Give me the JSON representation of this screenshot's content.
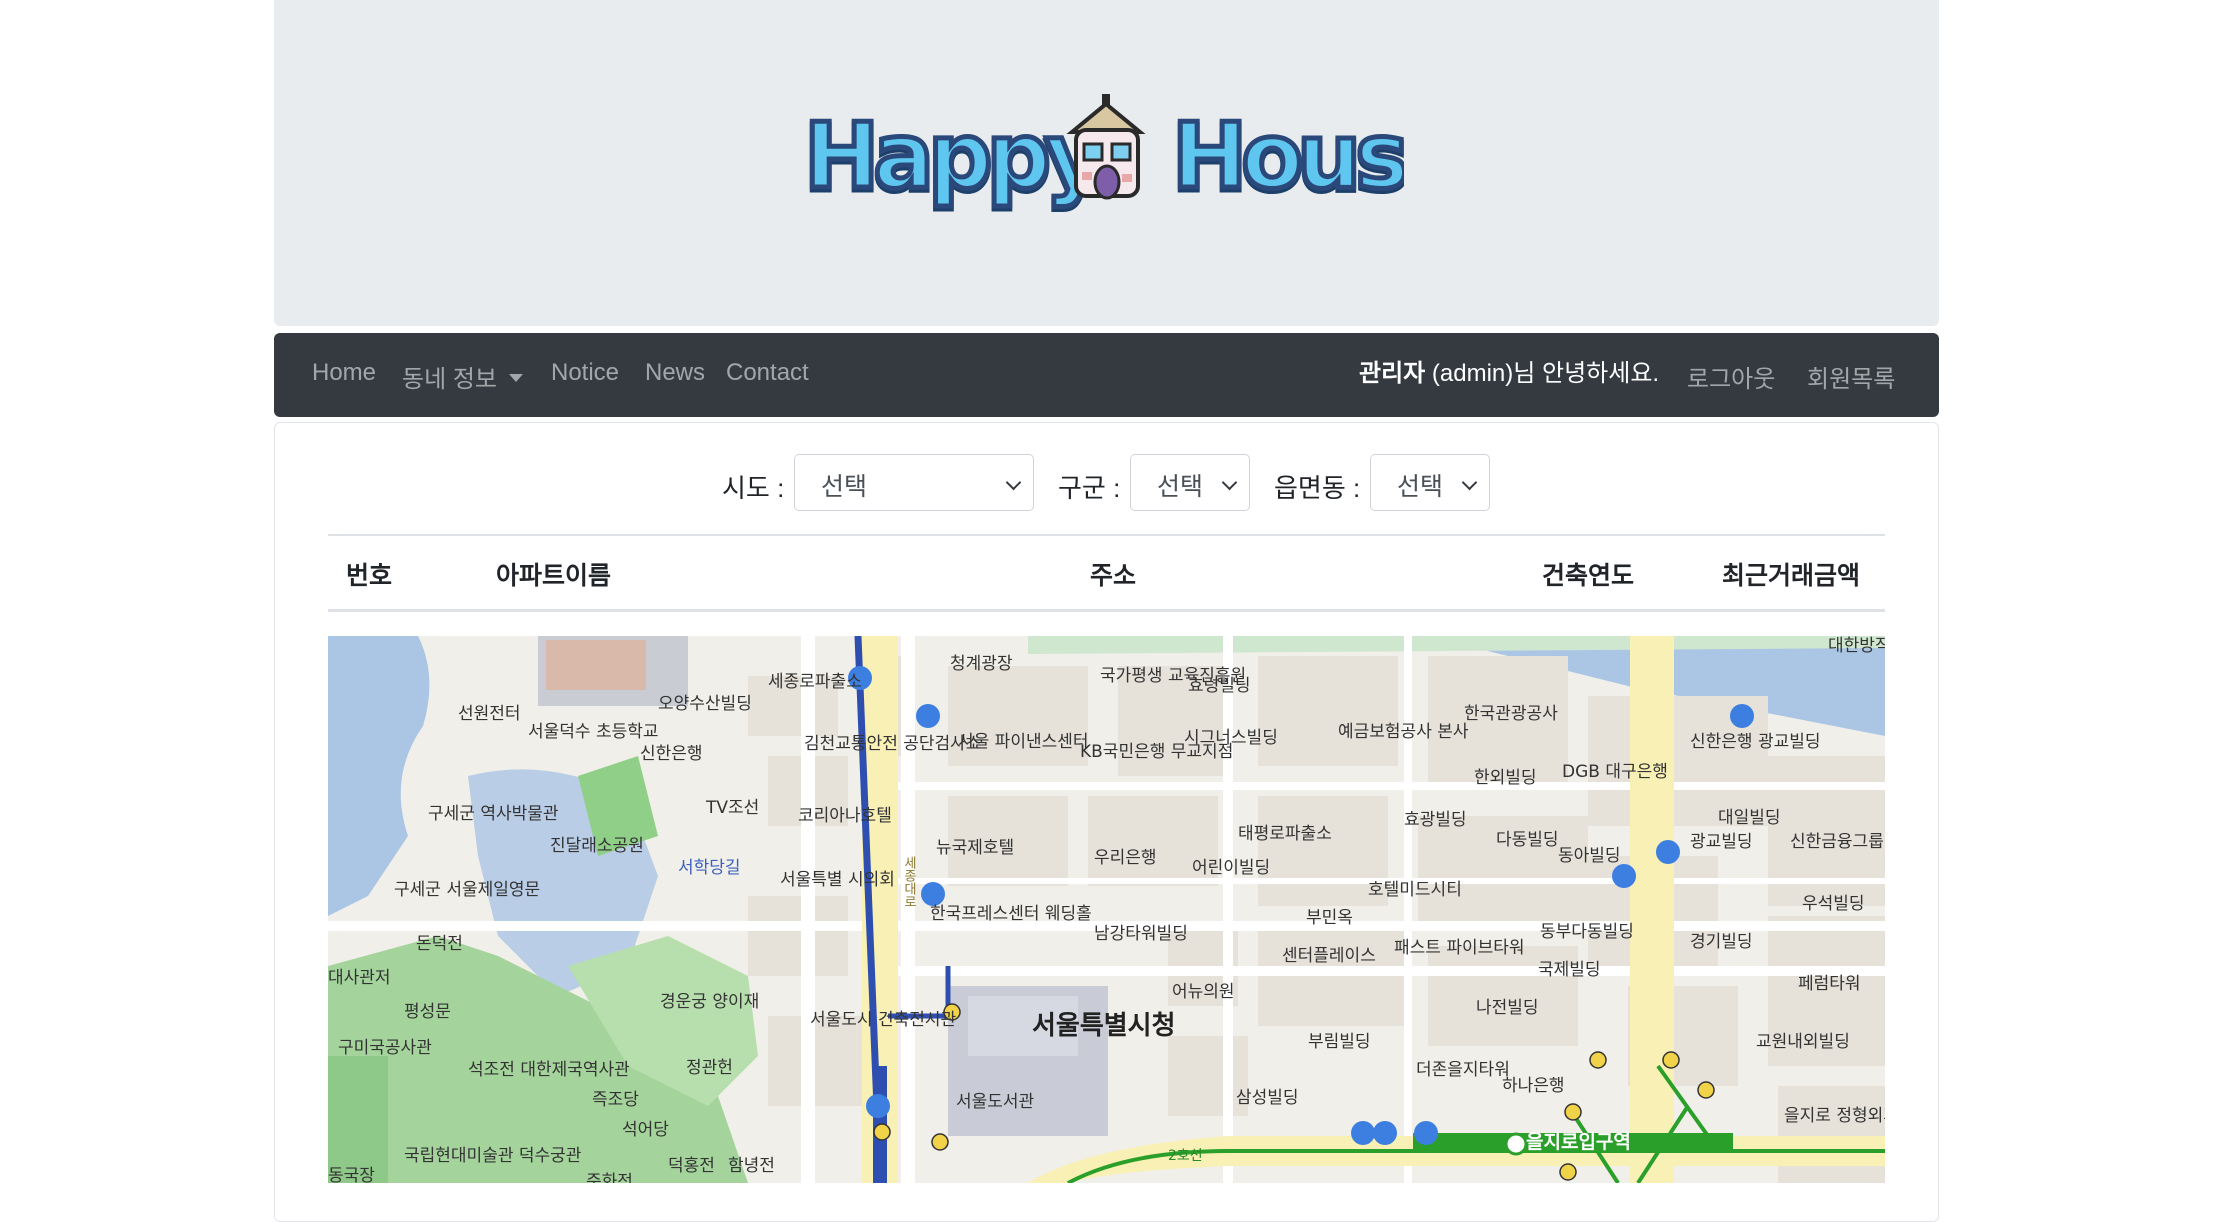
{
  "header": {
    "logo_text": "HappyHouse"
  },
  "navbar": {
    "home": "Home",
    "dong_info": "동네 정보",
    "notice": "Notice",
    "news": "News",
    "contact": "Contact",
    "greeting_name": "관리자",
    "greeting_rest": " (admin)님 안녕하세요.",
    "logout": "로그아웃",
    "members": "회원목록"
  },
  "filters": {
    "sido_label": "시도 :",
    "sido_value": "선택",
    "gugun_label": "구군 :",
    "gugun_value": "선택",
    "dong_label": "읍면동 :",
    "dong_value": "선택"
  },
  "table": {
    "headers": [
      "번호",
      "아파트이름",
      "주소",
      "건축연도",
      "최근거래금액"
    ]
  },
  "map": {
    "labels": [
      "대한방직 협회빌딩",
      "세종로파출소",
      "청계광장",
      "국가평생 교육진흥원",
      "효령빌딩",
      "오양수산빌딩",
      "선원전터",
      "서울덕수 초등학교",
      "김천교통안전 공단검사소",
      "서울 파이낸스센터",
      "KB국민은행 무교지점",
      "시그너스빌딩",
      "예금보험공사 본사",
      "한국관광공사",
      "신한은행 광교빌딩",
      "신한은행",
      "TV조선",
      "DGB 대구은행",
      "한외빌딩",
      "구세군 역사박물관",
      "코리아나호텔",
      "대일빌딩",
      "뉴국제호텔",
      "태평로파출소",
      "효광빌딩",
      "다동빌딩",
      "광교빌딩",
      "신한금융그룹",
      "진달래소공원",
      "우리은행",
      "어린이빌딩",
      "동아빌딩",
      "서학당길",
      "구세군 서울제일영문",
      "서울특별 시의회",
      "호텔미드시티",
      "한국프레스센터 웨딩홀",
      "부민옥",
      "우석빌딩",
      "돈덕전",
      "남강타워빌딩",
      "동부다동빌딩",
      "경기빌딩",
      "센터플레이스",
      "패스트 파이브타워",
      "국제빌딩",
      "대사관저",
      "페럼타워",
      "경운궁 양이재",
      "어뉴의원",
      "평성문",
      "서울도시 건축전시관",
      "서울특별시청",
      "나전빌딩",
      "구미국공사관",
      "부림빌딩",
      "교원내외빌딩",
      "석조전 대한제국역사관",
      "정관헌",
      "더존을지타워",
      "하나은행",
      "즉조당",
      "서울도서관",
      "삼성빌딩",
      "을지로 정형외과의원",
      "석어당",
      "국립현대미술관 덕수궁관",
      "덕홍전",
      "함녕전",
      "동국장",
      "을지로입구역",
      "준화전",
      "2호선",
      "세종대로"
    ]
  }
}
